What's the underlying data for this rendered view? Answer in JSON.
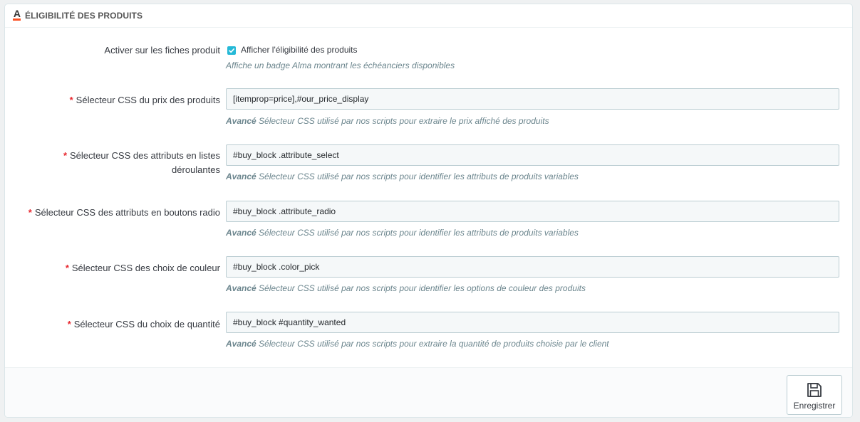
{
  "panel": {
    "title": "ÉLIGIBILITÉ DES PRODUITS",
    "logo_letter": "a"
  },
  "fields": {
    "activate": {
      "label": "Activer sur les fiches produit",
      "checkbox_label": "Afficher l'éligibilité des produits",
      "checked": true,
      "help": "Affiche un badge Alma montrant les échéanciers disponibles"
    },
    "price_selector": {
      "required": "*",
      "label": "Sélecteur CSS du prix des produits",
      "value": "[itemprop=price],#our_price_display",
      "help_strong": "Avancé",
      "help": "Sélecteur CSS utilisé par nos scripts pour extraire le prix affiché des produits"
    },
    "select_attributes": {
      "required": "*",
      "label_line1": "Sélecteur CSS des attributs en listes",
      "label_line2": "déroulantes",
      "value": "#buy_block .attribute_select",
      "help_strong": "Avancé",
      "help": "Sélecteur CSS utilisé par nos scripts pour identifier les attributs de produits variables"
    },
    "radio_attributes": {
      "required": "*",
      "label": "Sélecteur CSS des attributs en boutons radio",
      "value": "#buy_block .attribute_radio",
      "help_strong": "Avancé",
      "help": "Sélecteur CSS utilisé par nos scripts pour identifier les attributs de produits variables"
    },
    "color_pick": {
      "required": "*",
      "label": "Sélecteur CSS des choix de couleur",
      "value": "#buy_block .color_pick",
      "help_strong": "Avancé",
      "help": "Sélecteur CSS utilisé par nos scripts pour identifier les options de couleur des produits"
    },
    "quantity": {
      "required": "*",
      "label": "Sélecteur CSS du choix de quantité",
      "value": "#buy_block #quantity_wanted",
      "help_strong": "Avancé",
      "help": "Sélecteur CSS utilisé par nos scripts pour extraire la quantité de produits choisie par le client"
    }
  },
  "footer": {
    "save_label": "Enregistrer",
    "save_icon": "floppy-disk-icon"
  },
  "colors": {
    "accent": "#25b9d7",
    "required": "#e8282f",
    "brand": "#fa5022"
  }
}
